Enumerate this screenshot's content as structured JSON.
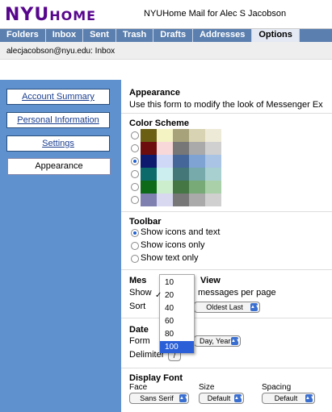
{
  "header": {
    "logo_nyu": "NYU",
    "logo_home": "HOME",
    "title": "NYUHome Mail for Alec S Jacobson"
  },
  "nav": {
    "tabs": [
      "Folders",
      "Inbox",
      "Sent",
      "Trash",
      "Drafts",
      "Addresses",
      "Options"
    ],
    "active": "Options"
  },
  "breadcrumb": "alecjacobson@nyu.edu:  Inbox",
  "sidebar": {
    "items": [
      "Account Summary",
      "Personal Information",
      "Settings",
      "Appearance"
    ],
    "current": "Appearance"
  },
  "appearance": {
    "title": "Appearance",
    "description": "Use this form to modify the look of Messenger Ex"
  },
  "color_scheme": {
    "title": "Color Scheme",
    "selected_index": 2,
    "rows": [
      [
        "#6b5f14",
        "#f4f3c4",
        "#a7a27a",
        "#d8d3b2",
        "#eeead8"
      ],
      [
        "#6e0d0d",
        "#f8d8d8",
        "#777777",
        "#aaaaaa",
        "#d0d0d0"
      ],
      [
        "#0d1a6e",
        "#d0d8f8",
        "#446699",
        "#7fa3d2",
        "#a9c4e4"
      ],
      [
        "#0d6a6a",
        "#cdeeee",
        "#447777",
        "#77aaaa",
        "#a9d0d0"
      ],
      [
        "#0d6a18",
        "#cdeecd",
        "#447744",
        "#77aa77",
        "#a9d0a9"
      ],
      [
        "#7f7fb0",
        "#d8d8f0",
        "#777777",
        "#aaaaaa",
        "#d0d0d0"
      ]
    ]
  },
  "toolbar": {
    "title": "Toolbar",
    "options": [
      "Show icons and text",
      "Show icons only",
      "Show text only"
    ],
    "selected_index": 0
  },
  "message_view": {
    "title_left": "Mes",
    "title_right": "View",
    "show_label": "Show",
    "per_page_label": "messages per page",
    "sort_label": "Sort",
    "sort_value": "Oldest Last"
  },
  "page_size_menu": {
    "options": [
      "10",
      "20",
      "40",
      "60",
      "80",
      "100"
    ],
    "checked": "20",
    "highlighted": "100"
  },
  "date": {
    "title": "Date",
    "format_label": "Form",
    "format_value": "Day, Year",
    "delimiter_label": "Delimiter",
    "delimiter_value": "/"
  },
  "display_font": {
    "title": "Display Font",
    "face_label": "Face",
    "face_value": "Sans Serif",
    "size_label": "Size",
    "size_value": "Default",
    "spacing_label": "Spacing",
    "spacing_value": "Default"
  }
}
